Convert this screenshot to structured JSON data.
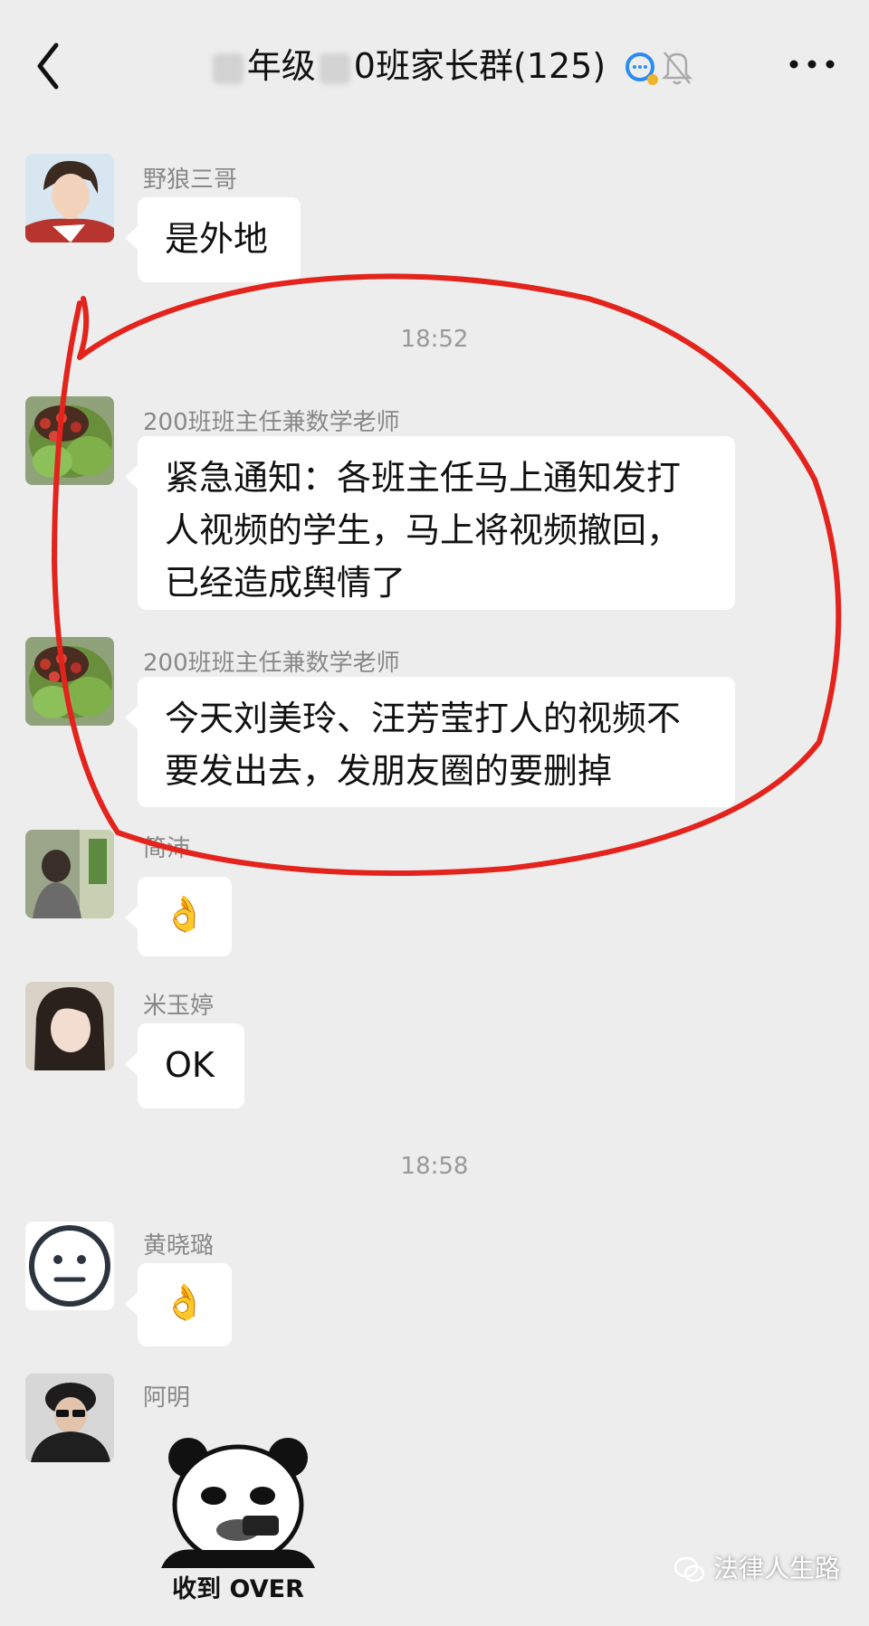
{
  "header": {
    "title_part1": "年级",
    "title_part2": "0班家长群(125)"
  },
  "messages": [
    {
      "sender": "野狼三哥",
      "text": "是外地"
    },
    {
      "time": "18:52"
    },
    {
      "sender": "200班班主任兼数学老师",
      "text": "紧急通知：各班主任马上通知发打人视频的学生，马上将视频撤回，已经造成舆情了"
    },
    {
      "sender": "200班班主任兼数学老师",
      "text": "今天刘美玲、汪芳莹打人的视频不要发出去，发朋友圈的要删掉"
    },
    {
      "sender": "简沛",
      "emoji": "👌"
    },
    {
      "sender": "米玉婷",
      "text": "OK"
    },
    {
      "time": "18:58"
    },
    {
      "sender": "黄晓璐",
      "emoji": "👌"
    },
    {
      "sender": "阿明",
      "sticker_caption": "收到 OVER"
    }
  ],
  "watermark": "法律人生路",
  "colors": {
    "background": "#ededed",
    "bubble": "#ffffff",
    "annotation": "#e3231c"
  },
  "icons": [
    "back-arrow-icon",
    "chat-group-icon",
    "mute-bell-icon",
    "more-dots-icon"
  ]
}
